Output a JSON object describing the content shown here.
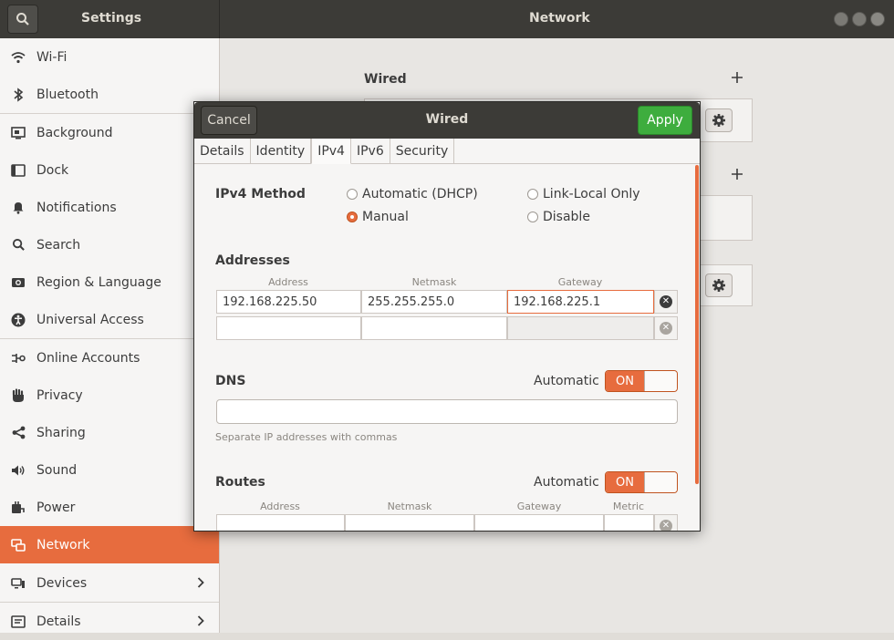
{
  "window": {
    "settings_title": "Settings",
    "panel_title": "Network"
  },
  "sidebar": {
    "items": [
      {
        "label": "Wi-Fi",
        "icon": "wifi-icon"
      },
      {
        "label": "Bluetooth",
        "icon": "bluetooth-icon"
      },
      {
        "label": "Background",
        "icon": "background-icon"
      },
      {
        "label": "Dock",
        "icon": "dock-icon"
      },
      {
        "label": "Notifications",
        "icon": "bell-icon"
      },
      {
        "label": "Search",
        "icon": "search-icon"
      },
      {
        "label": "Region & Language",
        "icon": "camera-icon"
      },
      {
        "label": "Universal Access",
        "icon": "accessibility-icon"
      },
      {
        "label": "Online Accounts",
        "icon": "online-accounts-icon"
      },
      {
        "label": "Privacy",
        "icon": "hand-icon"
      },
      {
        "label": "Sharing",
        "icon": "share-icon"
      },
      {
        "label": "Sound",
        "icon": "speaker-icon"
      },
      {
        "label": "Power",
        "icon": "power-icon"
      },
      {
        "label": "Network",
        "icon": "network-icon",
        "active": true
      },
      {
        "label": "Devices",
        "icon": "devices-icon",
        "chevron": true
      },
      {
        "label": "Details",
        "icon": "info-icon",
        "chevron": true
      }
    ]
  },
  "main": {
    "wired_label": "Wired"
  },
  "dialog": {
    "title": "Wired",
    "cancel_label": "Cancel",
    "apply_label": "Apply",
    "tabs": [
      "Details",
      "Identity",
      "IPv4",
      "IPv6",
      "Security"
    ],
    "active_tab": "IPv4",
    "ipv4_method_label": "IPv4 Method",
    "methods": {
      "automatic": "Automatic (DHCP)",
      "link_local": "Link-Local Only",
      "manual": "Manual",
      "disable": "Disable",
      "selected": "Manual"
    },
    "addresses": {
      "label": "Addresses",
      "columns": [
        "Address",
        "Netmask",
        "Gateway"
      ],
      "rows": [
        {
          "address": "192.168.225.50",
          "netmask": "255.255.255.0",
          "gateway": "192.168.225.1"
        },
        {
          "address": "",
          "netmask": "",
          "gateway": ""
        }
      ]
    },
    "dns": {
      "label": "DNS",
      "automatic_label": "Automatic",
      "switch_state": "ON",
      "value": "",
      "hint": "Separate IP addresses with commas"
    },
    "routes": {
      "label": "Routes",
      "automatic_label": "Automatic",
      "switch_state": "ON",
      "columns": [
        "Address",
        "Netmask",
        "Gateway",
        "Metric"
      ]
    }
  },
  "colors": {
    "accent": "#e76c3e",
    "apply_green": "#3ead3e",
    "titlebar": "#3c3b37"
  }
}
